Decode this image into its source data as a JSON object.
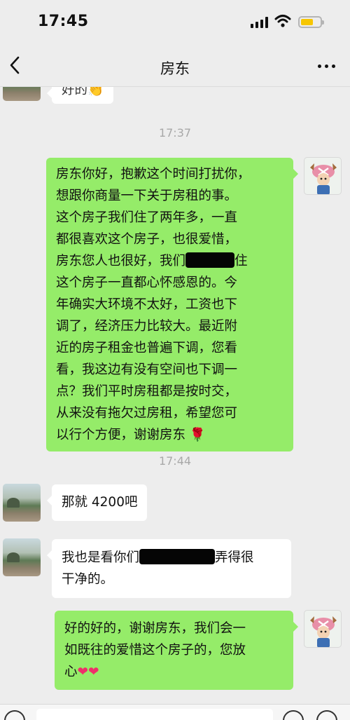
{
  "status_bar": {
    "time": "17:45"
  },
  "nav": {
    "title": "房东"
  },
  "timestamps": [
    "17:37",
    "17:44"
  ],
  "messages": {
    "partial": {
      "text": "好的",
      "emoji": "👏"
    },
    "request": {
      "lines": [
        "房东你好，抱歉这个时间打扰你，",
        "想跟你商量一下关于房租的事。",
        "这个房子我们住了两年多，一直",
        "都很喜欢这个房子，也很爱惜，",
        "房东您人也很好，我们",
        "住",
        "这个房子一直都心怀感恩的。今",
        "年确实大环境不太好，工资也下",
        "调了，经济压力比较大。最近附",
        "近的房子租金也普遍下调，您看",
        "看，我这边有没有空间也下调一",
        "点？我们平时房租都是按时交，",
        "从来没有拖欠过房租，希望您可",
        "以行个方便，谢谢房东"
      ],
      "emoji": "🌹"
    },
    "offer": {
      "text": "那就 4200吧"
    },
    "compliment": {
      "lines": [
        "我也是看你们",
        "弄得很",
        "干净的。"
      ]
    },
    "reply": {
      "lines": [
        "好的好的，谢谢房东，我们会一",
        "如既往的爱惜这个房子的，您放",
        "心"
      ],
      "emoji": "❤❤"
    }
  },
  "icons": {
    "back": "chevron-left-icon",
    "more": "more-dots-icon",
    "signal": "signal-icon",
    "wifi": "wifi-icon",
    "battery": "battery-icon",
    "voice": "voice-icon",
    "emoji": "emoji-icon",
    "add": "plus-icon"
  },
  "colors": {
    "outgoing_bubble": "#95ec69",
    "incoming_bubble": "#ffffff",
    "background": "#ededed",
    "battery": "#f7c600"
  }
}
